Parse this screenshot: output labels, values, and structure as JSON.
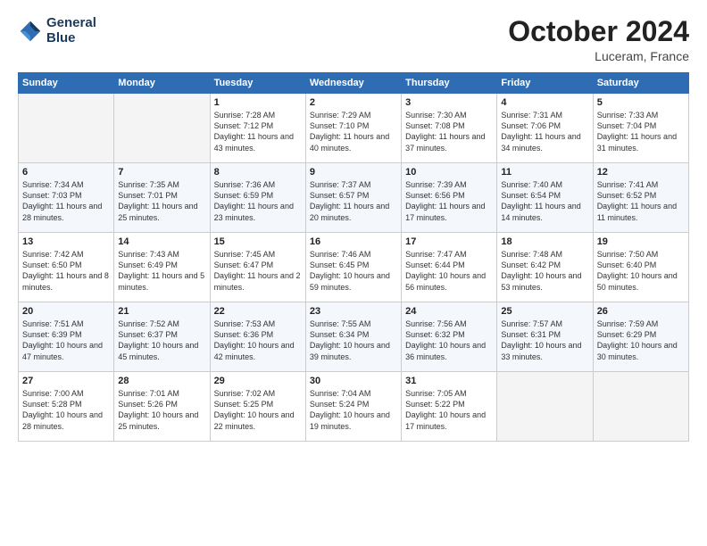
{
  "header": {
    "logo_line1": "General",
    "logo_line2": "Blue",
    "month": "October 2024",
    "location": "Luceram, France"
  },
  "days_of_week": [
    "Sunday",
    "Monday",
    "Tuesday",
    "Wednesday",
    "Thursday",
    "Friday",
    "Saturday"
  ],
  "weeks": [
    [
      {
        "day": "",
        "info": ""
      },
      {
        "day": "",
        "info": ""
      },
      {
        "day": "1",
        "info": "Sunrise: 7:28 AM\nSunset: 7:12 PM\nDaylight: 11 hours and 43 minutes."
      },
      {
        "day": "2",
        "info": "Sunrise: 7:29 AM\nSunset: 7:10 PM\nDaylight: 11 hours and 40 minutes."
      },
      {
        "day": "3",
        "info": "Sunrise: 7:30 AM\nSunset: 7:08 PM\nDaylight: 11 hours and 37 minutes."
      },
      {
        "day": "4",
        "info": "Sunrise: 7:31 AM\nSunset: 7:06 PM\nDaylight: 11 hours and 34 minutes."
      },
      {
        "day": "5",
        "info": "Sunrise: 7:33 AM\nSunset: 7:04 PM\nDaylight: 11 hours and 31 minutes."
      }
    ],
    [
      {
        "day": "6",
        "info": "Sunrise: 7:34 AM\nSunset: 7:03 PM\nDaylight: 11 hours and 28 minutes."
      },
      {
        "day": "7",
        "info": "Sunrise: 7:35 AM\nSunset: 7:01 PM\nDaylight: 11 hours and 25 minutes."
      },
      {
        "day": "8",
        "info": "Sunrise: 7:36 AM\nSunset: 6:59 PM\nDaylight: 11 hours and 23 minutes."
      },
      {
        "day": "9",
        "info": "Sunrise: 7:37 AM\nSunset: 6:57 PM\nDaylight: 11 hours and 20 minutes."
      },
      {
        "day": "10",
        "info": "Sunrise: 7:39 AM\nSunset: 6:56 PM\nDaylight: 11 hours and 17 minutes."
      },
      {
        "day": "11",
        "info": "Sunrise: 7:40 AM\nSunset: 6:54 PM\nDaylight: 11 hours and 14 minutes."
      },
      {
        "day": "12",
        "info": "Sunrise: 7:41 AM\nSunset: 6:52 PM\nDaylight: 11 hours and 11 minutes."
      }
    ],
    [
      {
        "day": "13",
        "info": "Sunrise: 7:42 AM\nSunset: 6:50 PM\nDaylight: 11 hours and 8 minutes."
      },
      {
        "day": "14",
        "info": "Sunrise: 7:43 AM\nSunset: 6:49 PM\nDaylight: 11 hours and 5 minutes."
      },
      {
        "day": "15",
        "info": "Sunrise: 7:45 AM\nSunset: 6:47 PM\nDaylight: 11 hours and 2 minutes."
      },
      {
        "day": "16",
        "info": "Sunrise: 7:46 AM\nSunset: 6:45 PM\nDaylight: 10 hours and 59 minutes."
      },
      {
        "day": "17",
        "info": "Sunrise: 7:47 AM\nSunset: 6:44 PM\nDaylight: 10 hours and 56 minutes."
      },
      {
        "day": "18",
        "info": "Sunrise: 7:48 AM\nSunset: 6:42 PM\nDaylight: 10 hours and 53 minutes."
      },
      {
        "day": "19",
        "info": "Sunrise: 7:50 AM\nSunset: 6:40 PM\nDaylight: 10 hours and 50 minutes."
      }
    ],
    [
      {
        "day": "20",
        "info": "Sunrise: 7:51 AM\nSunset: 6:39 PM\nDaylight: 10 hours and 47 minutes."
      },
      {
        "day": "21",
        "info": "Sunrise: 7:52 AM\nSunset: 6:37 PM\nDaylight: 10 hours and 45 minutes."
      },
      {
        "day": "22",
        "info": "Sunrise: 7:53 AM\nSunset: 6:36 PM\nDaylight: 10 hours and 42 minutes."
      },
      {
        "day": "23",
        "info": "Sunrise: 7:55 AM\nSunset: 6:34 PM\nDaylight: 10 hours and 39 minutes."
      },
      {
        "day": "24",
        "info": "Sunrise: 7:56 AM\nSunset: 6:32 PM\nDaylight: 10 hours and 36 minutes."
      },
      {
        "day": "25",
        "info": "Sunrise: 7:57 AM\nSunset: 6:31 PM\nDaylight: 10 hours and 33 minutes."
      },
      {
        "day": "26",
        "info": "Sunrise: 7:59 AM\nSunset: 6:29 PM\nDaylight: 10 hours and 30 minutes."
      }
    ],
    [
      {
        "day": "27",
        "info": "Sunrise: 7:00 AM\nSunset: 5:28 PM\nDaylight: 10 hours and 28 minutes."
      },
      {
        "day": "28",
        "info": "Sunrise: 7:01 AM\nSunset: 5:26 PM\nDaylight: 10 hours and 25 minutes."
      },
      {
        "day": "29",
        "info": "Sunrise: 7:02 AM\nSunset: 5:25 PM\nDaylight: 10 hours and 22 minutes."
      },
      {
        "day": "30",
        "info": "Sunrise: 7:04 AM\nSunset: 5:24 PM\nDaylight: 10 hours and 19 minutes."
      },
      {
        "day": "31",
        "info": "Sunrise: 7:05 AM\nSunset: 5:22 PM\nDaylight: 10 hours and 17 minutes."
      },
      {
        "day": "",
        "info": ""
      },
      {
        "day": "",
        "info": ""
      }
    ]
  ]
}
